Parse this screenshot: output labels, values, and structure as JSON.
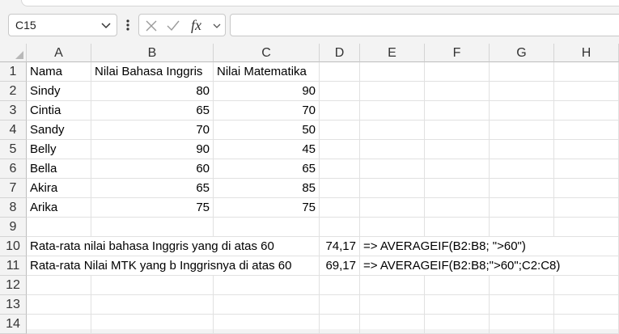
{
  "name_box": {
    "value": "C15"
  },
  "formula_bar": {
    "cancel_icon": "close-icon",
    "enter_icon": "check-icon",
    "fx_label": "fx",
    "value": ""
  },
  "columns": [
    "A",
    "B",
    "C",
    "D",
    "E",
    "F",
    "G",
    "H"
  ],
  "rows": [
    "1",
    "2",
    "3",
    "4",
    "5",
    "6",
    "7",
    "8",
    "9",
    "10",
    "11",
    "12",
    "13",
    "14"
  ],
  "table": {
    "headers": [
      "Nama",
      "Nilai Bahasa Inggris",
      "Nilai Matematika"
    ],
    "records": [
      {
        "nama": "Sindy",
        "inggris": "80",
        "mtk": "90"
      },
      {
        "nama": "Cintia",
        "inggris": "65",
        "mtk": "70"
      },
      {
        "nama": "Sandy",
        "inggris": "70",
        "mtk": "50"
      },
      {
        "nama": "Belly",
        "inggris": "90",
        "mtk": "45"
      },
      {
        "nama": "Bella",
        "inggris": "60",
        "mtk": "65"
      },
      {
        "nama": "Akira",
        "inggris": "65",
        "mtk": "85"
      },
      {
        "nama": "Arika",
        "inggris": "75",
        "mtk": "75"
      }
    ]
  },
  "summary": {
    "row10": {
      "label": "Rata-rata nilai bahasa Inggris yang di atas 60",
      "value": "74,17",
      "formula": "=> AVERAGEIF(B2:B8; \">60\")"
    },
    "row11": {
      "label": "Rata-rata Nilai MTK yang b Inggrisnya di atas 60",
      "value": "69,17",
      "formula": "=> AVERAGEIF(B2:B8;\">60\";C2:C8)"
    }
  }
}
